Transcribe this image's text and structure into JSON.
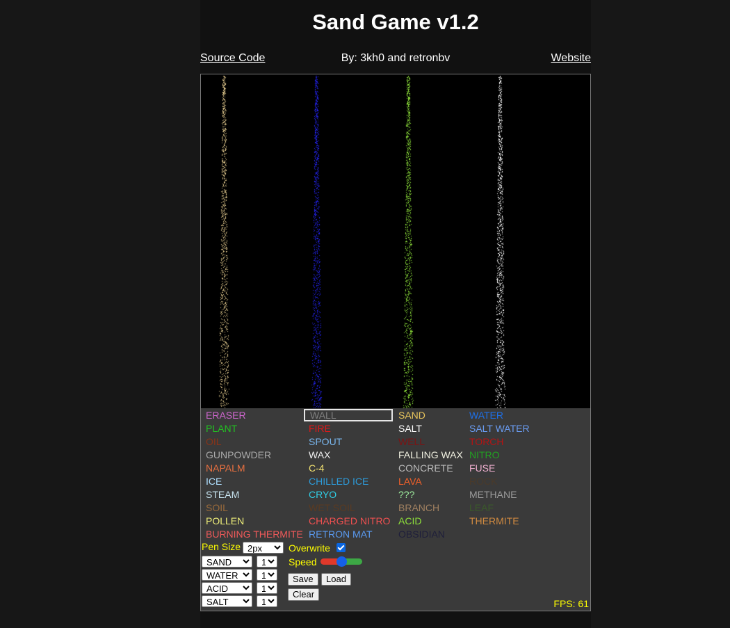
{
  "header": {
    "title": "Sand Game v1.2",
    "source_link": "Source Code",
    "byline": "By: 3kh0 and retronbv",
    "website_link": "Website"
  },
  "canvas": {
    "background": "#000000",
    "streams": [
      {
        "material": "SAND",
        "color": "#dcc48a"
      },
      {
        "material": "WATER",
        "color": "#2222ee"
      },
      {
        "material": "ACID",
        "color": "#8ee03a"
      },
      {
        "material": "SALT",
        "color": "#ffffff"
      }
    ]
  },
  "elements": [
    {
      "label": "ERASER",
      "color": "#cc66cc"
    },
    {
      "label": "WALL",
      "color": "#808080",
      "selected": true
    },
    {
      "label": "SAND",
      "color": "#e6c35c"
    },
    {
      "label": "WATER",
      "color": "#1e6fe6"
    },
    {
      "label": "PLANT",
      "color": "#22c022"
    },
    {
      "label": "FIRE",
      "color": "#e01818"
    },
    {
      "label": "SALT",
      "color": "#ffffff"
    },
    {
      "label": "SALT WATER",
      "color": "#6a9cf2"
    },
    {
      "label": "OIL",
      "color": "#8a3418"
    },
    {
      "label": "SPOUT",
      "color": "#7ab8f0"
    },
    {
      "label": "WELL",
      "color": "#7a1414"
    },
    {
      "label": "TORCH",
      "color": "#b41414"
    },
    {
      "label": "GUNPOWDER",
      "color": "#aaaaaa"
    },
    {
      "label": "WAX",
      "color": "#f0f0f0"
    },
    {
      "label": "FALLING WAX",
      "color": "#f0f0e0"
    },
    {
      "label": "NITRO",
      "color": "#22a022"
    },
    {
      "label": "NAPALM",
      "color": "#e87040"
    },
    {
      "label": "C-4",
      "color": "#f0e070"
    },
    {
      "label": "CONCRETE",
      "color": "#bbbbbb"
    },
    {
      "label": "FUSE",
      "color": "#f0b0d0"
    },
    {
      "label": "ICE",
      "color": "#b0e0ff"
    },
    {
      "label": "CHILLED ICE",
      "color": "#2d9cdb"
    },
    {
      "label": "LAVA",
      "color": "#f0602a"
    },
    {
      "label": "ROCK",
      "color": "#4a3a2a"
    },
    {
      "label": "STEAM",
      "color": "#c8e4f0"
    },
    {
      "label": "CRYO",
      "color": "#30d0e8"
    },
    {
      "label": "???",
      "color": "#a0f0a0"
    },
    {
      "label": "METHANE",
      "color": "#9a9a9a"
    },
    {
      "label": "SOIL",
      "color": "#9a6a3a"
    },
    {
      "label": "WET SOIL",
      "color": "#5a3a22"
    },
    {
      "label": "BRANCH",
      "color": "#a08060"
    },
    {
      "label": "LEAF",
      "color": "#3a5a2a"
    },
    {
      "label": "POLLEN",
      "color": "#f0f07a"
    },
    {
      "label": "CHARGED NITRO",
      "color": "#f05050"
    },
    {
      "label": "ACID",
      "color": "#8ee03a"
    },
    {
      "label": "THERMITE",
      "color": "#d08a40"
    },
    {
      "label": "BURNING THERMITE",
      "color": "#f05a5a"
    },
    {
      "label": "RETRON MAT",
      "color": "#5a9af0"
    },
    {
      "label": "OBSIDIAN",
      "color": "#1e1e3a"
    }
  ],
  "controls": {
    "pen_size_label": "Pen Size",
    "pen_size_value": "2px",
    "overwrite_label": "Overwrite",
    "overwrite_checked": true,
    "speed_label": "Speed",
    "speed_level": 0.5,
    "spawners": [
      {
        "material": "SAND",
        "count": "1"
      },
      {
        "material": "WATER",
        "count": "1"
      },
      {
        "material": "ACID",
        "count": "1"
      },
      {
        "material": "SALT",
        "count": "1"
      }
    ],
    "save_label": "Save",
    "load_label": "Load",
    "clear_label": "Clear",
    "fps_text": "FPS: 61"
  }
}
